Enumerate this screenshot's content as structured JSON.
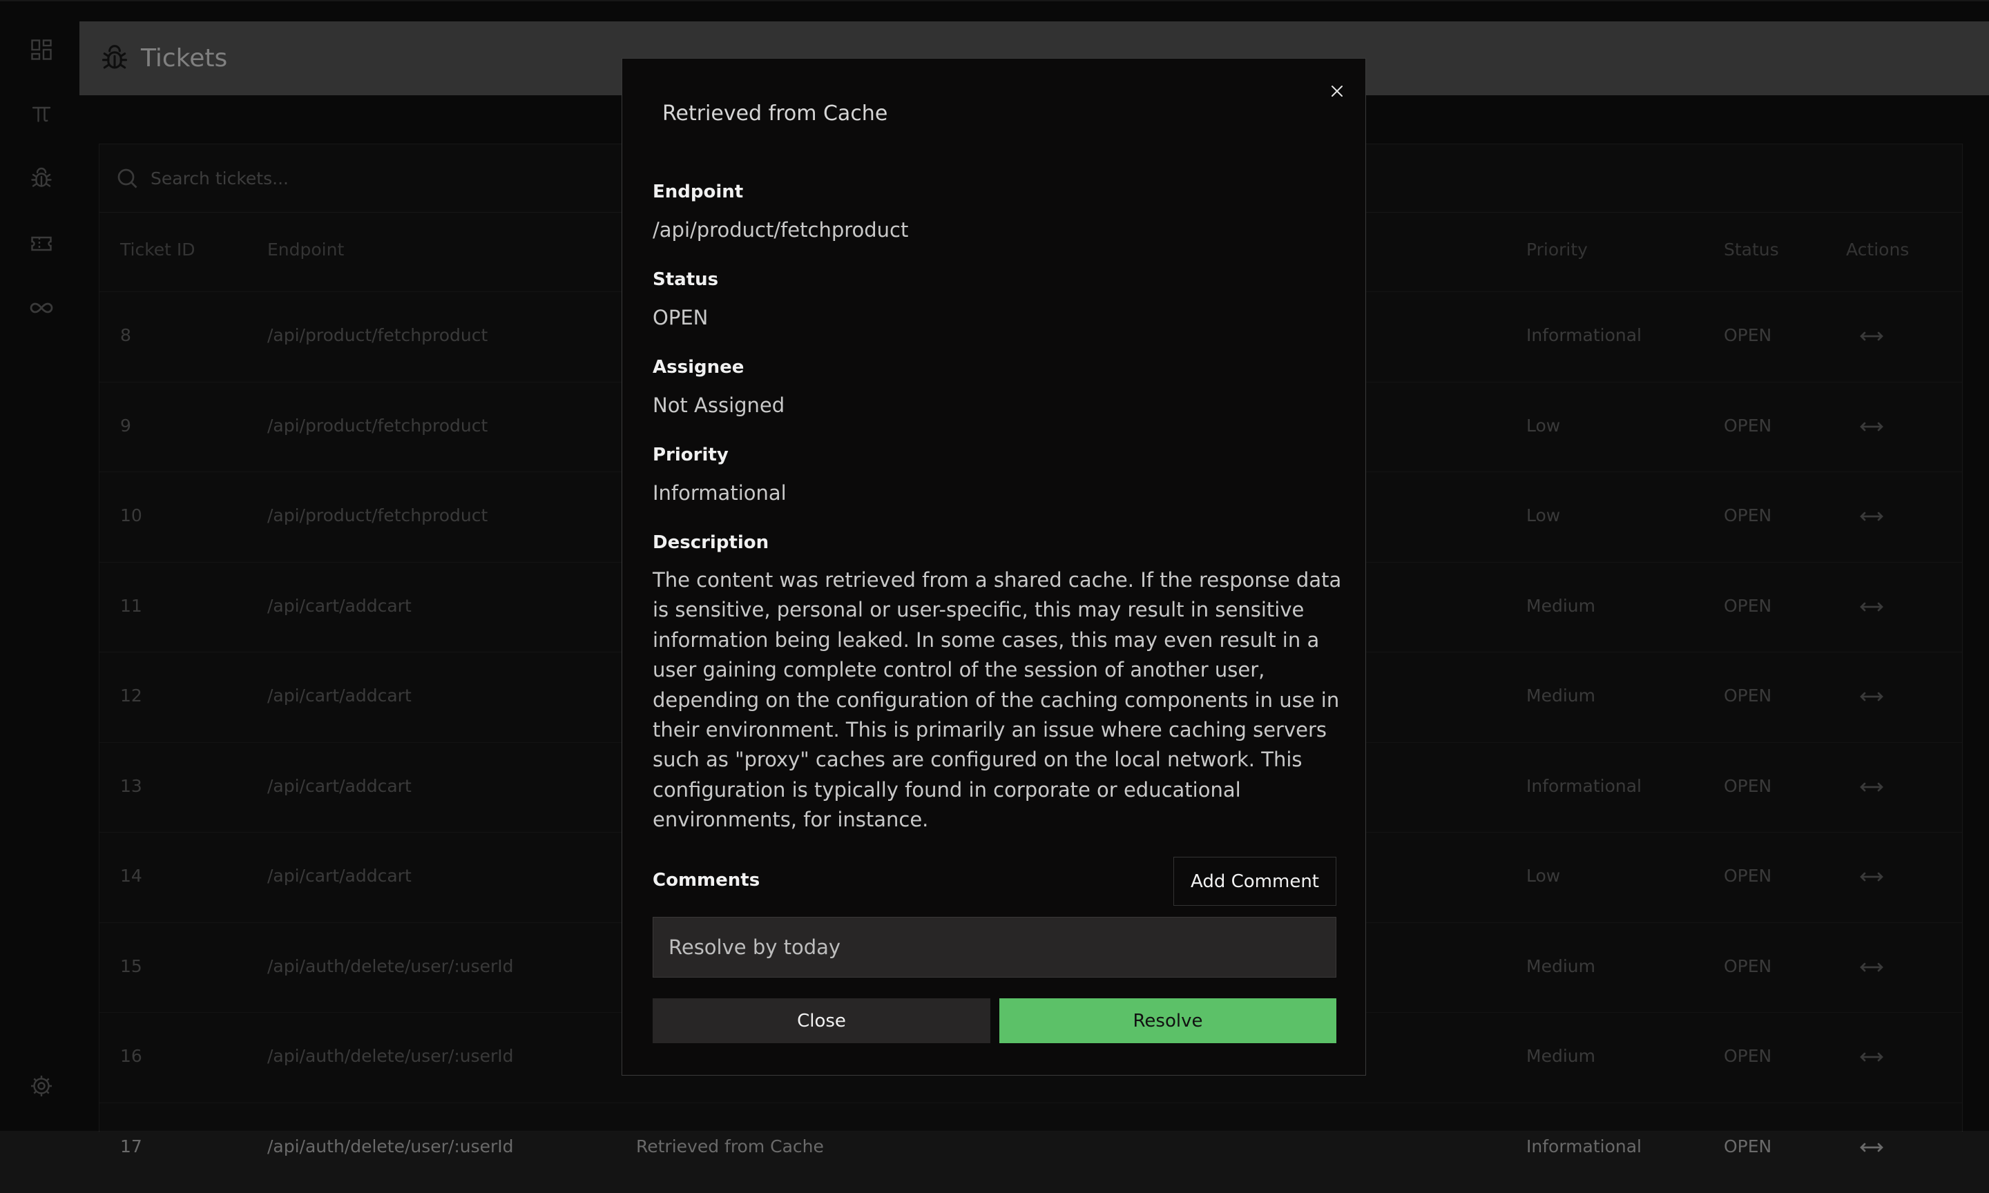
{
  "app": {
    "page_title": "Tickets",
    "nav_icons": [
      "dashboard-icon",
      "pi-icon",
      "bug-icon",
      "ticket-icon",
      "infinity-icon"
    ],
    "settings_icon": "gear-icon"
  },
  "search": {
    "placeholder": "Search tickets..."
  },
  "table": {
    "headers": [
      "Ticket ID",
      "Endpoint",
      "Priority",
      "Status",
      "Actions"
    ],
    "rows": [
      {
        "id": "8",
        "endpoint": "/api/product/fetchproduct",
        "priority": "Informational",
        "status": "OPEN"
      },
      {
        "id": "9",
        "endpoint": "/api/product/fetchproduct",
        "priority": "Low",
        "status": "OPEN"
      },
      {
        "id": "10",
        "endpoint": "/api/product/fetchproduct",
        "priority": "Low",
        "status": "OPEN"
      },
      {
        "id": "11",
        "endpoint": "/api/cart/addcart",
        "priority": "Medium",
        "status": "OPEN"
      },
      {
        "id": "12",
        "endpoint": "/api/cart/addcart",
        "priority": "Medium",
        "status": "OPEN"
      },
      {
        "id": "13",
        "endpoint": "/api/cart/addcart",
        "priority": "Informational",
        "status": "OPEN"
      },
      {
        "id": "14",
        "endpoint": "/api/cart/addcart",
        "priority": "Low",
        "status": "OPEN"
      },
      {
        "id": "15",
        "endpoint": "/api/auth/delete/user/:userId",
        "priority": "Medium",
        "status": "OPEN"
      },
      {
        "id": "16",
        "endpoint": "/api/auth/delete/user/:userId",
        "priority": "Medium",
        "status": "OPEN"
      },
      {
        "id": "17",
        "endpoint": "/api/auth/delete/user/:userId",
        "title": "Retrieved from Cache",
        "priority": "Informational",
        "status": "OPEN"
      }
    ]
  },
  "modal": {
    "title": "Retrieved from Cache",
    "endpoint_label": "Endpoint",
    "endpoint_value": "/api/product/fetchproduct",
    "status_label": "Status",
    "status_value": "OPEN",
    "assignee_label": "Assignee",
    "assignee_value": "Not Assigned",
    "priority_label": "Priority",
    "priority_value": "Informational",
    "description_label": "Description",
    "description_value": "The content was retrieved from a shared cache. If the response data is sensitive, personal or user-specific, this may result in sensitive information being leaked. In some cases, this may even result in a user gaining complete control of the session of another user, depending on the configuration of the caching components in use in their environment. This is primarily an issue where caching servers such as \"proxy\" caches are configured on the local network. This configuration is typically found in corporate or educational environments, for instance.",
    "comments_label": "Comments",
    "add_comment_label": "Add Comment",
    "comment_value": "Resolve by today",
    "close_label": "Close",
    "resolve_label": "Resolve",
    "close_icon": "close-icon"
  },
  "colors": {
    "accent_green": "#5cc168",
    "header_bg": "#5c5c5c",
    "modal_bg": "#0b0a0a"
  }
}
